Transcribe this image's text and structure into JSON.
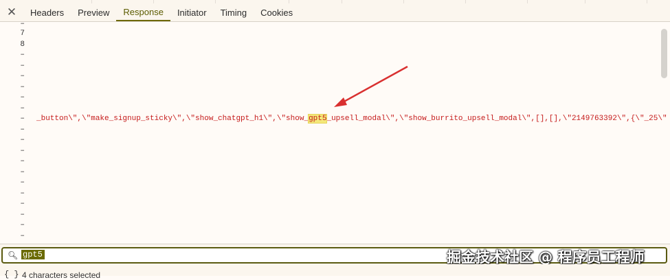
{
  "tabs": [
    {
      "label": "Headers"
    },
    {
      "label": "Preview"
    },
    {
      "label": "Response",
      "active": true
    },
    {
      "label": "Initiator"
    },
    {
      "label": "Timing"
    },
    {
      "label": "Cookies"
    }
  ],
  "close_glyph": "✕",
  "gutter_lines": [
    "–",
    "7",
    "8",
    "–",
    "–",
    "–",
    "–",
    "–",
    "–",
    "–",
    "–",
    "–",
    "–",
    "–",
    "–",
    "–",
    "–",
    "–",
    "–",
    "–",
    "–",
    "–",
    "–",
    "–",
    "–",
    "–"
  ],
  "code": {
    "before": "_button\\\",\\\"make_signup_sticky\\\",\\\"show_chatgpt_h1\\\",\\\"show_",
    "match": "gpt5",
    "after": "_upsell_modal\\\",\\\"show_burrito_upsell_modal\\\",[],[],\\\"2149763392\\\",{\\\"_25\\\""
  },
  "search": {
    "icon": "search-icon",
    "value": "gpt5"
  },
  "watermark": "掘金技术社区 @ 程序员工程师",
  "status": {
    "braces": "{ }",
    "text": "4 characters selected"
  },
  "colors": {
    "accent": "#6e6800",
    "code_string": "#c51a1a",
    "highlight": "#f4e87a",
    "arrow": "#d93030"
  }
}
